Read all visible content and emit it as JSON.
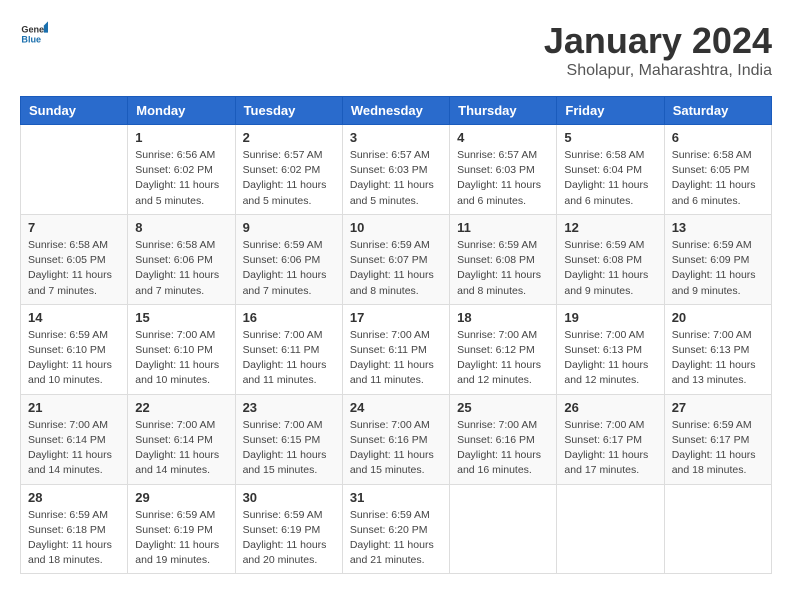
{
  "logo": {
    "text_general": "General",
    "text_blue": "Blue"
  },
  "header": {
    "title": "January 2024",
    "subtitle": "Sholapur, Maharashtra, India"
  },
  "days_of_week": [
    "Sunday",
    "Monday",
    "Tuesday",
    "Wednesday",
    "Thursday",
    "Friday",
    "Saturday"
  ],
  "weeks": [
    [
      {
        "day": "",
        "info": ""
      },
      {
        "day": "1",
        "info": "Sunrise: 6:56 AM\nSunset: 6:02 PM\nDaylight: 11 hours and 5 minutes."
      },
      {
        "day": "2",
        "info": "Sunrise: 6:57 AM\nSunset: 6:02 PM\nDaylight: 11 hours and 5 minutes."
      },
      {
        "day": "3",
        "info": "Sunrise: 6:57 AM\nSunset: 6:03 PM\nDaylight: 11 hours and 5 minutes."
      },
      {
        "day": "4",
        "info": "Sunrise: 6:57 AM\nSunset: 6:03 PM\nDaylight: 11 hours and 6 minutes."
      },
      {
        "day": "5",
        "info": "Sunrise: 6:58 AM\nSunset: 6:04 PM\nDaylight: 11 hours and 6 minutes."
      },
      {
        "day": "6",
        "info": "Sunrise: 6:58 AM\nSunset: 6:05 PM\nDaylight: 11 hours and 6 minutes."
      }
    ],
    [
      {
        "day": "7",
        "info": "Sunrise: 6:58 AM\nSunset: 6:05 PM\nDaylight: 11 hours and 7 minutes."
      },
      {
        "day": "8",
        "info": "Sunrise: 6:58 AM\nSunset: 6:06 PM\nDaylight: 11 hours and 7 minutes."
      },
      {
        "day": "9",
        "info": "Sunrise: 6:59 AM\nSunset: 6:06 PM\nDaylight: 11 hours and 7 minutes."
      },
      {
        "day": "10",
        "info": "Sunrise: 6:59 AM\nSunset: 6:07 PM\nDaylight: 11 hours and 8 minutes."
      },
      {
        "day": "11",
        "info": "Sunrise: 6:59 AM\nSunset: 6:08 PM\nDaylight: 11 hours and 8 minutes."
      },
      {
        "day": "12",
        "info": "Sunrise: 6:59 AM\nSunset: 6:08 PM\nDaylight: 11 hours and 9 minutes."
      },
      {
        "day": "13",
        "info": "Sunrise: 6:59 AM\nSunset: 6:09 PM\nDaylight: 11 hours and 9 minutes."
      }
    ],
    [
      {
        "day": "14",
        "info": "Sunrise: 6:59 AM\nSunset: 6:10 PM\nDaylight: 11 hours and 10 minutes."
      },
      {
        "day": "15",
        "info": "Sunrise: 7:00 AM\nSunset: 6:10 PM\nDaylight: 11 hours and 10 minutes."
      },
      {
        "day": "16",
        "info": "Sunrise: 7:00 AM\nSunset: 6:11 PM\nDaylight: 11 hours and 11 minutes."
      },
      {
        "day": "17",
        "info": "Sunrise: 7:00 AM\nSunset: 6:11 PM\nDaylight: 11 hours and 11 minutes."
      },
      {
        "day": "18",
        "info": "Sunrise: 7:00 AM\nSunset: 6:12 PM\nDaylight: 11 hours and 12 minutes."
      },
      {
        "day": "19",
        "info": "Sunrise: 7:00 AM\nSunset: 6:13 PM\nDaylight: 11 hours and 12 minutes."
      },
      {
        "day": "20",
        "info": "Sunrise: 7:00 AM\nSunset: 6:13 PM\nDaylight: 11 hours and 13 minutes."
      }
    ],
    [
      {
        "day": "21",
        "info": "Sunrise: 7:00 AM\nSunset: 6:14 PM\nDaylight: 11 hours and 14 minutes."
      },
      {
        "day": "22",
        "info": "Sunrise: 7:00 AM\nSunset: 6:14 PM\nDaylight: 11 hours and 14 minutes."
      },
      {
        "day": "23",
        "info": "Sunrise: 7:00 AM\nSunset: 6:15 PM\nDaylight: 11 hours and 15 minutes."
      },
      {
        "day": "24",
        "info": "Sunrise: 7:00 AM\nSunset: 6:16 PM\nDaylight: 11 hours and 15 minutes."
      },
      {
        "day": "25",
        "info": "Sunrise: 7:00 AM\nSunset: 6:16 PM\nDaylight: 11 hours and 16 minutes."
      },
      {
        "day": "26",
        "info": "Sunrise: 7:00 AM\nSunset: 6:17 PM\nDaylight: 11 hours and 17 minutes."
      },
      {
        "day": "27",
        "info": "Sunrise: 6:59 AM\nSunset: 6:17 PM\nDaylight: 11 hours and 18 minutes."
      }
    ],
    [
      {
        "day": "28",
        "info": "Sunrise: 6:59 AM\nSunset: 6:18 PM\nDaylight: 11 hours and 18 minutes."
      },
      {
        "day": "29",
        "info": "Sunrise: 6:59 AM\nSunset: 6:19 PM\nDaylight: 11 hours and 19 minutes."
      },
      {
        "day": "30",
        "info": "Sunrise: 6:59 AM\nSunset: 6:19 PM\nDaylight: 11 hours and 20 minutes."
      },
      {
        "day": "31",
        "info": "Sunrise: 6:59 AM\nSunset: 6:20 PM\nDaylight: 11 hours and 21 minutes."
      },
      {
        "day": "",
        "info": ""
      },
      {
        "day": "",
        "info": ""
      },
      {
        "day": "",
        "info": ""
      }
    ]
  ]
}
